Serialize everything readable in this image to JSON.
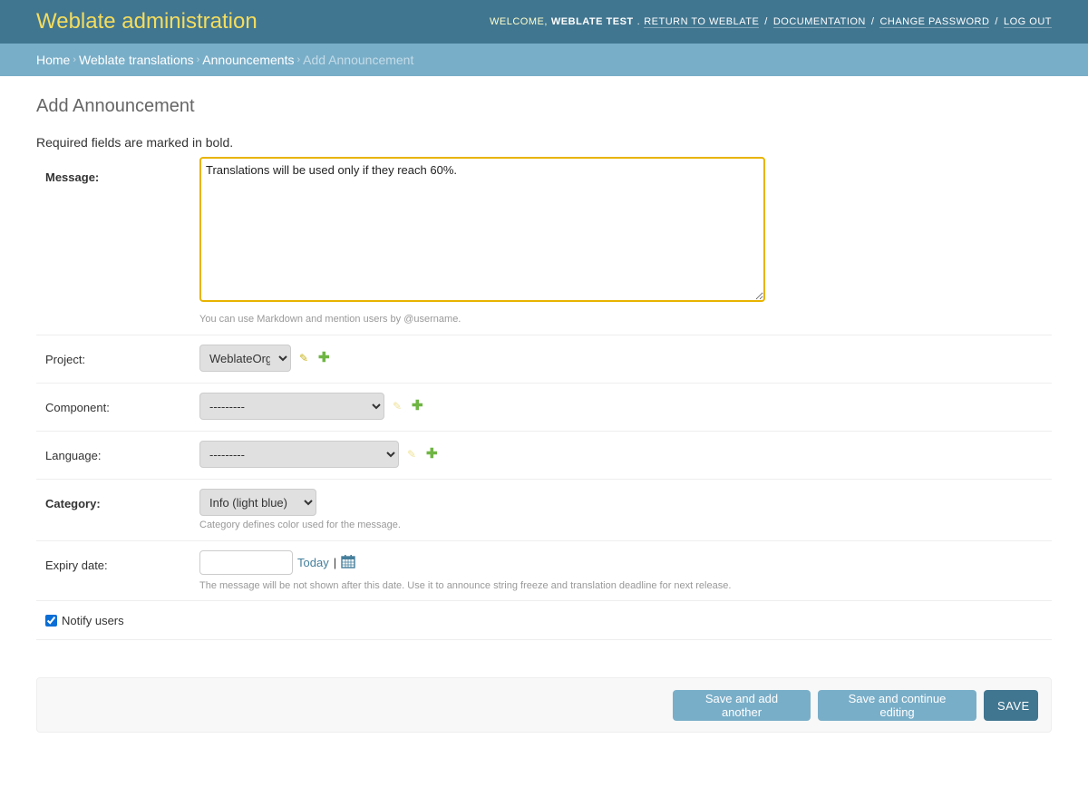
{
  "header": {
    "site_title": "Weblate administration",
    "welcome": "Welcome,",
    "username": "Weblate Test",
    "links": {
      "return": "Return to Weblate",
      "docs": "Documentation",
      "password": "Change password",
      "logout": "Log out"
    }
  },
  "breadcrumbs": {
    "home": "Home",
    "app": "Weblate translations",
    "model": "Announcements",
    "current": "Add Announcement"
  },
  "page": {
    "title": "Add Announcement",
    "required_note": "Required fields are marked in bold."
  },
  "form": {
    "message": {
      "label": "Message:",
      "value": "Translations will be used only if they reach 60%.",
      "help": "You can use Markdown and mention users by @username."
    },
    "project": {
      "label": "Project:",
      "value": "WeblateOrg"
    },
    "component": {
      "label": "Component:",
      "value": "---------"
    },
    "language": {
      "label": "Language:",
      "value": "---------"
    },
    "category": {
      "label": "Category:",
      "value": "Info (light blue)",
      "help": "Category defines color used for the message."
    },
    "expiry": {
      "label": "Expiry date:",
      "value": "",
      "today": "Today",
      "help": "The message will be not shown after this date. Use it to announce string freeze and translation deadline for next release."
    },
    "notify": {
      "label": "Notify users",
      "checked": true
    }
  },
  "buttons": {
    "save_add": "Save and add another",
    "save_continue": "Save and continue editing",
    "save": "Save"
  },
  "colors": {
    "header": "#417690",
    "breadcrumbs": "#79aec8",
    "title": "#f5dd5d",
    "focus": "#e8b400"
  },
  "icons": {
    "edit": "pencil-icon",
    "add": "plus-icon",
    "calendar": "calendar-icon"
  }
}
